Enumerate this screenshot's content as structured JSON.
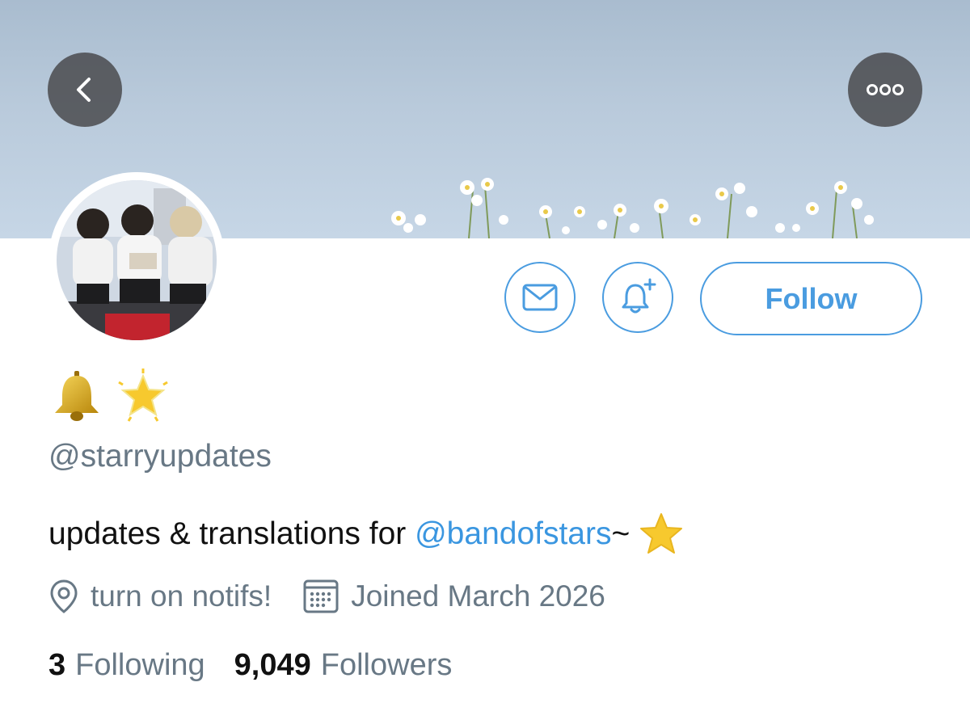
{
  "header": {
    "back_icon": "chevron-left-icon",
    "more_icon": "more-horizontal-icon"
  },
  "actions": {
    "message_icon": "mail-icon",
    "notify_icon": "bell-plus-icon",
    "follow_label": "Follow"
  },
  "profile": {
    "display_name_emoji": [
      "bell-emoji",
      "glowing-star-emoji"
    ],
    "handle": "@starryupdates",
    "bio_text": "updates & translations for ",
    "bio_mention": "@bandofstars",
    "bio_suffix": "~",
    "location": "turn on notifs!",
    "joined": "Joined March 2026",
    "following_count": "3",
    "following_label": "Following",
    "followers_count": "9,049",
    "followers_label": "Followers"
  },
  "colors": {
    "accent": "#4a9ce0",
    "secondary_text": "#687885",
    "primary_text": "#111111"
  }
}
